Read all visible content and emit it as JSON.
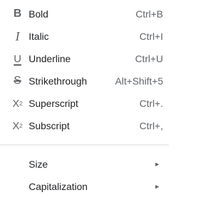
{
  "menu": {
    "items": [
      {
        "label": "Bold",
        "shortcut": "Ctrl+B",
        "icon": "bold-icon"
      },
      {
        "label": "Italic",
        "shortcut": "Ctrl+I",
        "icon": "italic-icon"
      },
      {
        "label": "Underline",
        "shortcut": "Ctrl+U",
        "icon": "underline-icon"
      },
      {
        "label": "Strikethrough",
        "shortcut": "Alt+Shift+5",
        "icon": "strikethrough-icon"
      },
      {
        "label": "Superscript",
        "shortcut": "Ctrl+.",
        "icon": "superscript-icon"
      },
      {
        "label": "Subscript",
        "shortcut": "Ctrl+,",
        "icon": "subscript-icon"
      }
    ],
    "submenus": [
      {
        "label": "Size",
        "arrow": "►"
      },
      {
        "label": "Capitalization",
        "arrow": "►"
      }
    ]
  }
}
